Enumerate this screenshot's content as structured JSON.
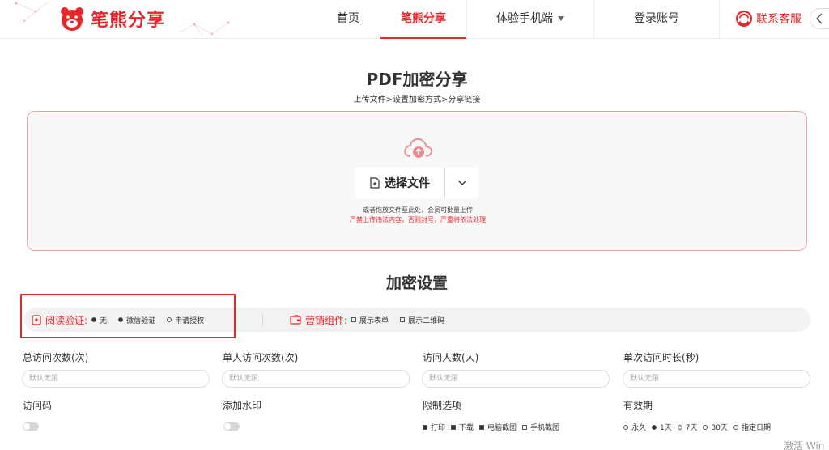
{
  "brand": {
    "name": "笔熊分享",
    "color": "#e8262b"
  },
  "nav": {
    "items": [
      {
        "label": "首页",
        "active": false
      },
      {
        "label": "笔熊分享",
        "active": true
      },
      {
        "label": "体验手机端",
        "active": false,
        "dropdown": true
      },
      {
        "label": "登录账号",
        "active": false
      }
    ],
    "service": "联系客服"
  },
  "main": {
    "title": "PDF加密分享",
    "steps": "上传文件>设置加密方式>分享链接",
    "upload": {
      "choose_label": "选择文件",
      "hint": "或者拖放文件至此处，会员可批量上传",
      "warning": "严禁上传违法内容，否则封号，严重将依法处理"
    }
  },
  "settings": {
    "title": "加密设置",
    "read_verify": {
      "label": "阅读验证:",
      "options": [
        {
          "label": "无",
          "selected": true
        },
        {
          "label": "微信验证",
          "selected": true
        },
        {
          "label": "申请授权",
          "selected": false
        }
      ]
    },
    "marketing": {
      "label": "营销组件:",
      "options": [
        {
          "label": "展示表单",
          "checked": false
        },
        {
          "label": "展示二维码",
          "checked": false
        }
      ]
    },
    "fields": [
      {
        "label": "总访问次数(次)",
        "placeholder": "默认无限"
      },
      {
        "label": "单人访问次数(次)",
        "placeholder": "默认无限"
      },
      {
        "label": "访问人数(人)",
        "placeholder": "默认无限"
      },
      {
        "label": "单次访问时长(秒)",
        "placeholder": "默认无限"
      }
    ],
    "access_code": {
      "label": "访问码",
      "enabled": false
    },
    "watermark": {
      "label": "添加水印",
      "enabled": false
    },
    "limits": {
      "label": "限制选项",
      "options": [
        {
          "label": "打印",
          "checked": true
        },
        {
          "label": "下载",
          "checked": true
        },
        {
          "label": "电脑截图",
          "checked": true
        },
        {
          "label": "手机截图",
          "checked": false
        }
      ]
    },
    "validity": {
      "label": "有效期",
      "options": [
        {
          "label": "永久",
          "selected": false
        },
        {
          "label": "1天",
          "selected": true
        },
        {
          "label": "7天",
          "selected": false
        },
        {
          "label": "30天",
          "selected": false
        },
        {
          "label": "指定日期",
          "selected": false
        }
      ]
    }
  },
  "os_watermark": "激活 Win"
}
